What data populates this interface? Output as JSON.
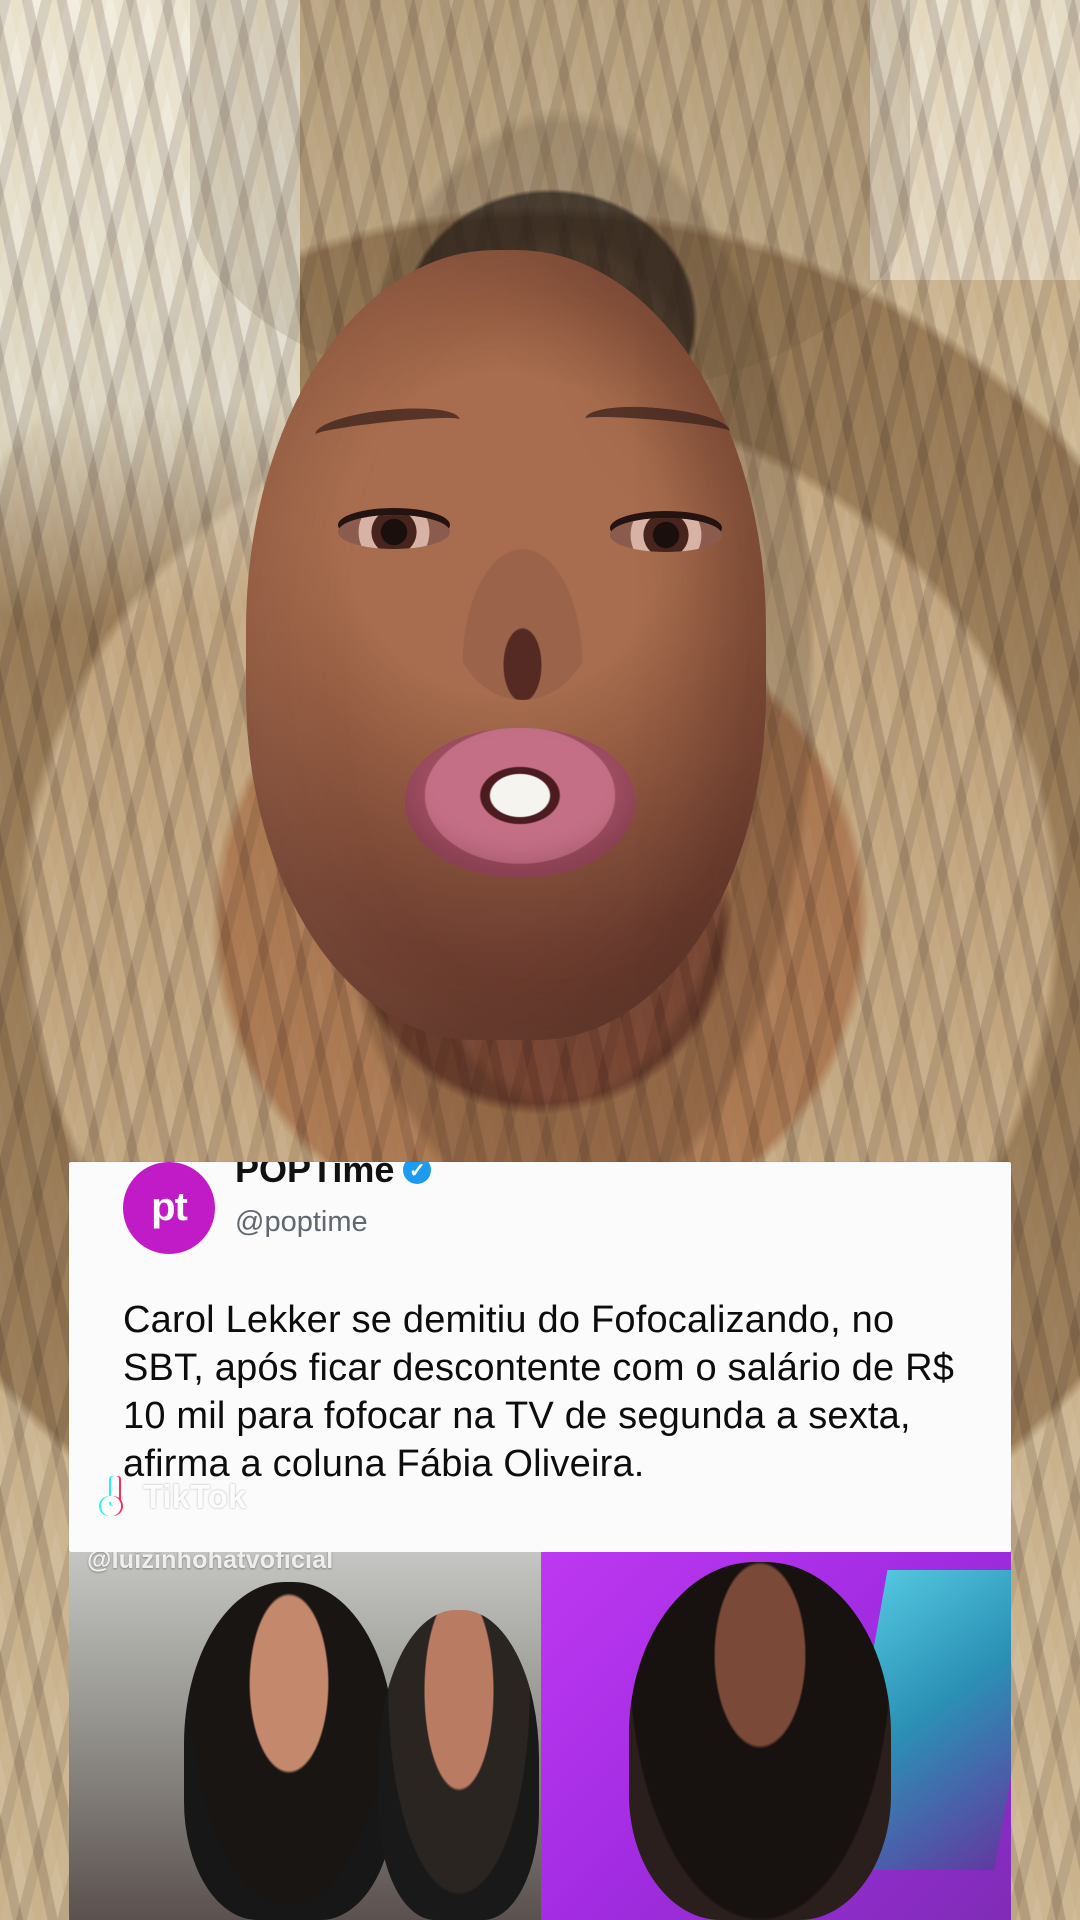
{
  "video": {
    "embedded_post": {
      "account_name": "POPTime",
      "avatar_text": "pt",
      "handle": "@poptime",
      "text": "Carol Lekker se demitiu do Fofocalizando, no SBT, após ficar descontente com o salário de R$ 10 mil para fofocar na TV de segunda a sexta, afirma a coluna Fábia Oliveira."
    },
    "watermark": {
      "platform": "TikTok"
    },
    "media_strip": {
      "handle_overlay": "@luizinhohatvoficial"
    }
  },
  "colors": {
    "avatar_background": "#c11bc8",
    "verified_badge": "#1d9bf0",
    "right_video_background": "#bd38f1"
  }
}
